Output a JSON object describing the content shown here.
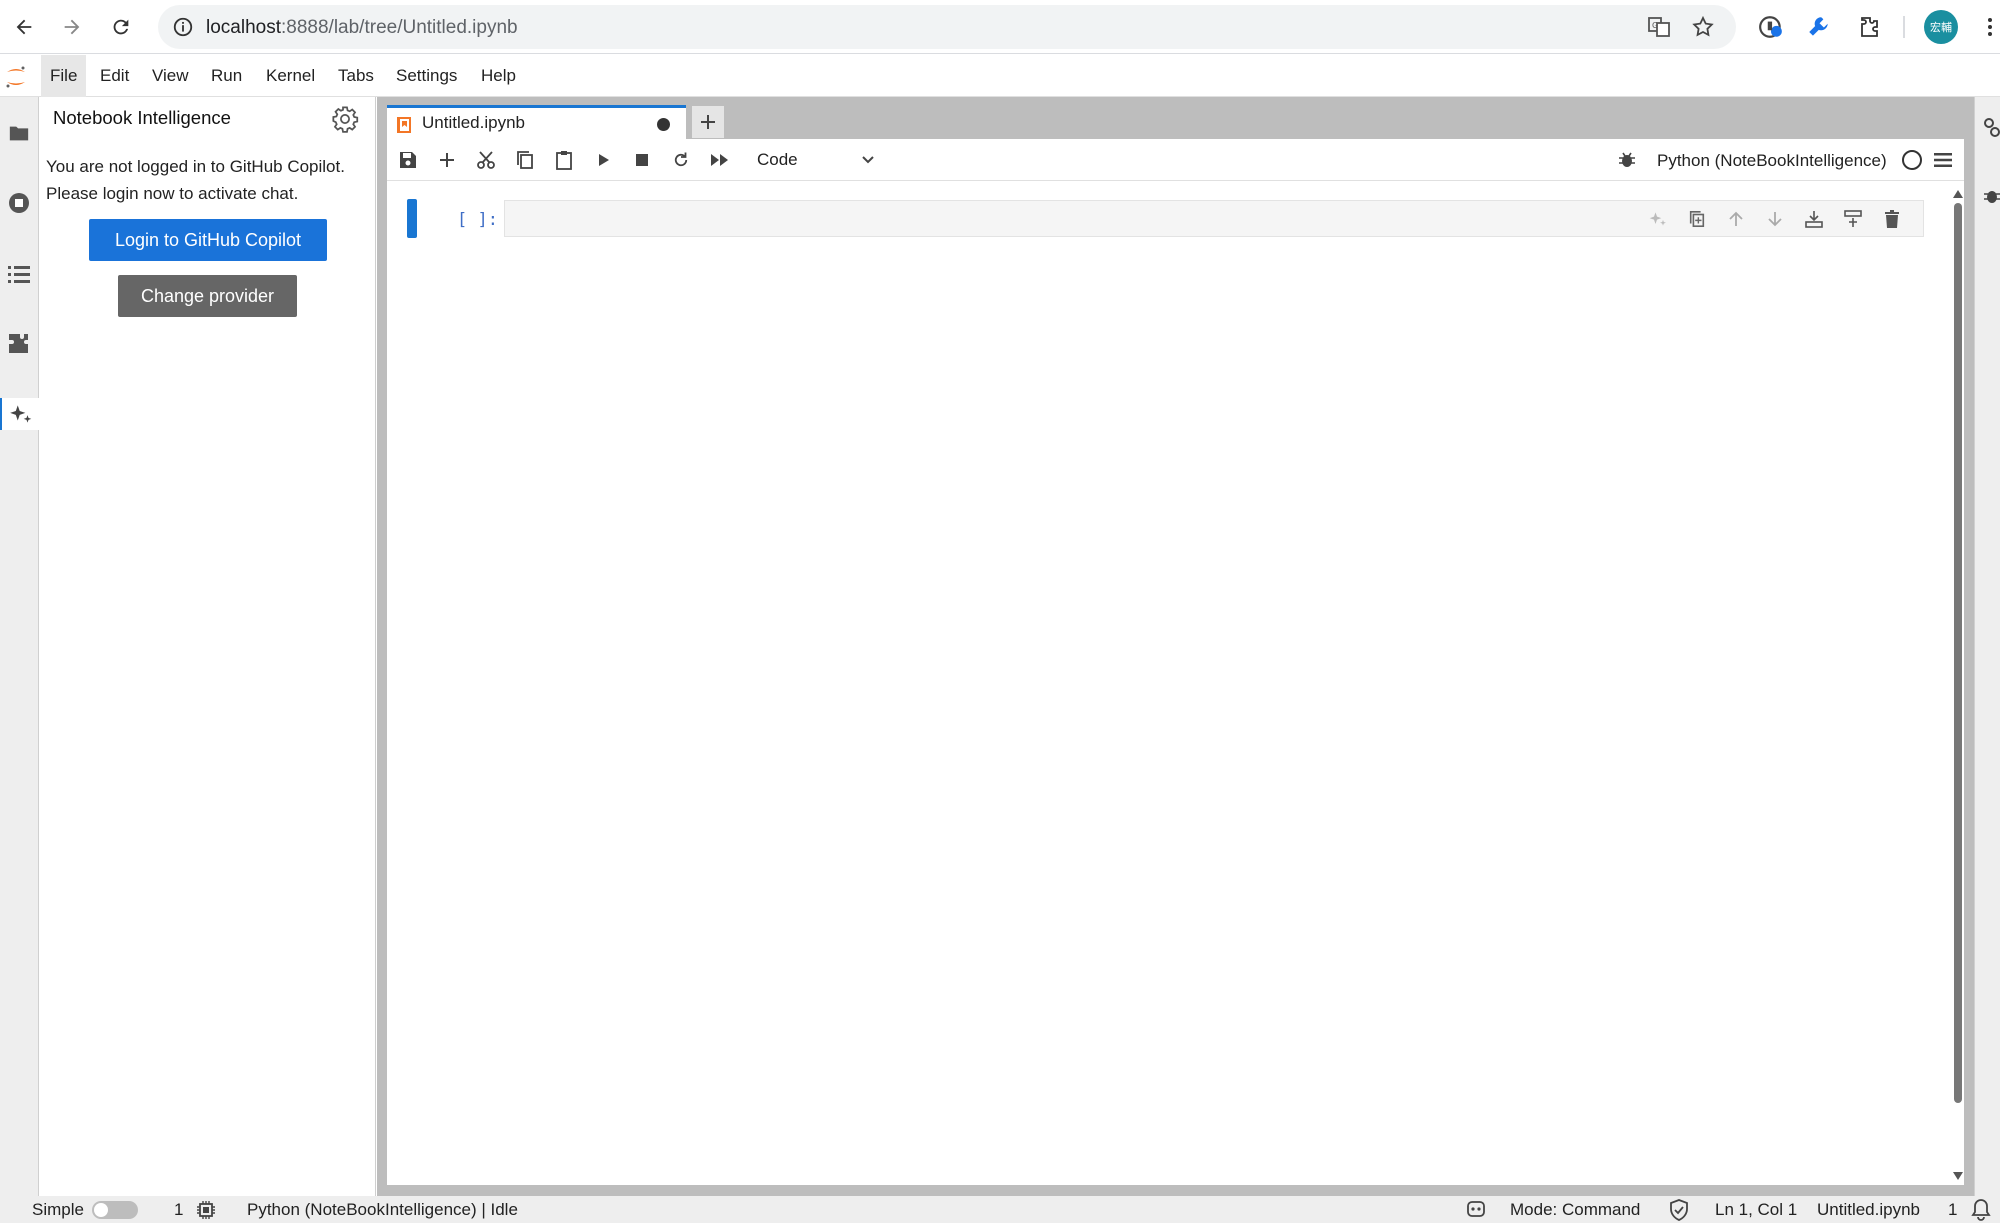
{
  "browser": {
    "url_host": "localhost",
    "url_rest": ":8888/lab/tree/Untitled.ipynb",
    "profile_initials": "宏輔"
  },
  "menu": {
    "items": [
      "File",
      "Edit",
      "View",
      "Run",
      "Kernel",
      "Tabs",
      "Settings",
      "Help"
    ]
  },
  "side_panel": {
    "title": "Notebook Intelligence",
    "message_line1": "You are not logged in to GitHub Copilot.",
    "message_line2": "Please login now to activate chat.",
    "login_button": "Login to GitHub Copilot",
    "change_provider_button": "Change provider"
  },
  "notebook": {
    "tab_label": "Untitled.ipynb",
    "cell_type": "Code",
    "kernel_name": "Python (NoteBookIntelligence)",
    "cell_prompt": "[ ]:"
  },
  "status_bar": {
    "mode_label": "Simple",
    "terminals_count": "1",
    "kernel_status": "Python (NoteBookIntelligence) | Idle",
    "mode": "Mode: Command",
    "cursor": "Ln 1, Col 1",
    "file": "Untitled.ipynb",
    "notifications": "1"
  },
  "colors": {
    "accent": "#1976d2",
    "login_button": "#1a73d9",
    "provider_button": "#666666",
    "jupyter_orange": "#f37626"
  }
}
